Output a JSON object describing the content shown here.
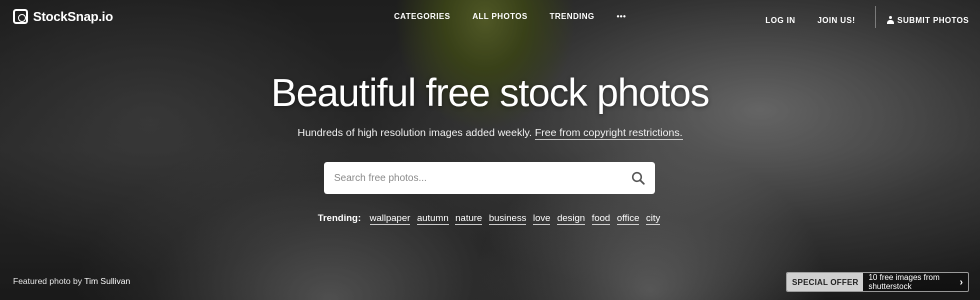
{
  "brand": {
    "name": "StockSnap.io",
    "icon": "camera-icon"
  },
  "nav": {
    "center": [
      "CATEGORIES",
      "ALL PHOTOS",
      "TRENDING",
      "•••"
    ],
    "login": "LOG IN",
    "join": "JOIN US!",
    "submit": "SUBMIT PHOTOS",
    "submit_icon": "user-icon"
  },
  "hero": {
    "title": "Beautiful free stock photos",
    "subtitle": "Hundreds of high resolution images added weekly.",
    "subtitle_link": "Free from copyright restrictions."
  },
  "search": {
    "placeholder": "Search free photos...",
    "icon": "search-icon"
  },
  "trending": {
    "label": "Trending:",
    "tags": [
      "wallpaper",
      "autumn",
      "nature",
      "business",
      "love",
      "design",
      "food",
      "office",
      "city"
    ]
  },
  "credit": {
    "prefix": "Featured photo by",
    "name": "Tim Sullivan"
  },
  "offer": {
    "badge": "SPECIAL OFFER",
    "text": "10 free images from shutterstock",
    "chevron": "›"
  },
  "colors": {
    "search_bg": "#ffffff",
    "offer_badge": "#d0d0d0"
  }
}
